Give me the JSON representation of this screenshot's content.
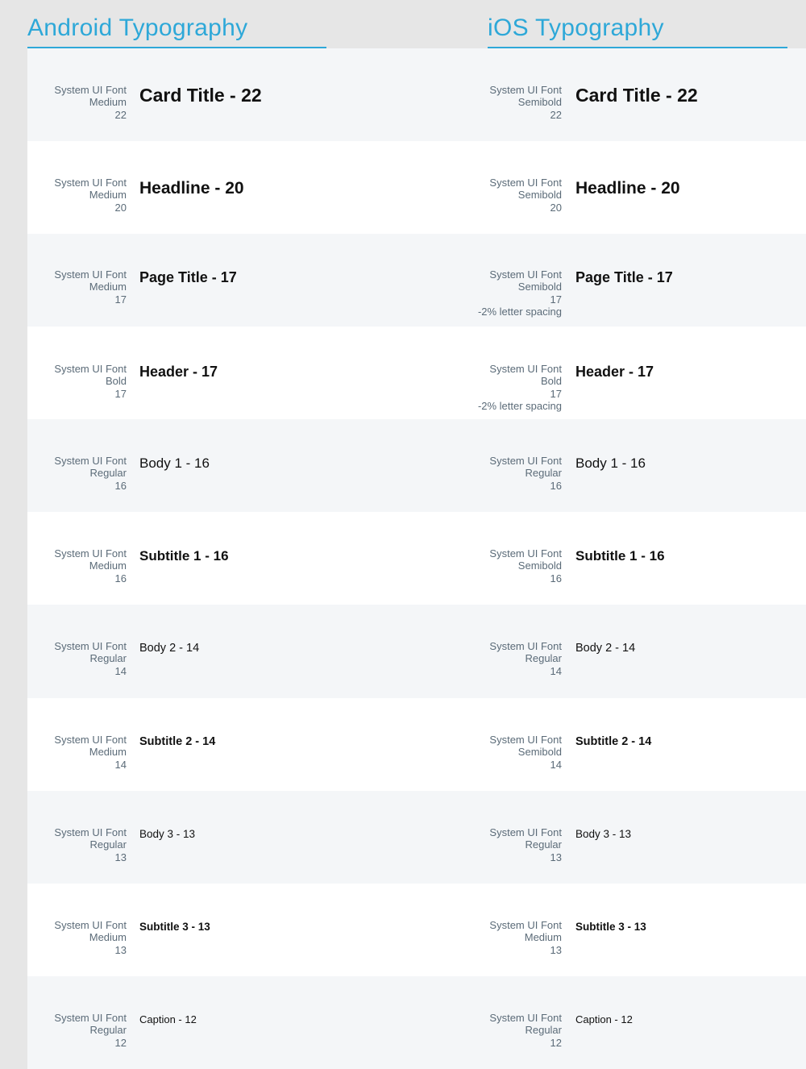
{
  "headings": {
    "android": "Android Typography",
    "ios": "iOS Typography"
  },
  "rows": [
    {
      "android": {
        "meta": [
          "System UI Font",
          "Medium",
          "22"
        ],
        "sample": "Card Title - 22"
      },
      "ios": {
        "meta": [
          "System UI Font",
          "Semibold",
          "22"
        ],
        "sample": "Card Title - 22"
      }
    },
    {
      "android": {
        "meta": [
          "System UI Font",
          "Medium",
          "20"
        ],
        "sample": "Headline - 20"
      },
      "ios": {
        "meta": [
          "System UI Font",
          "Semibold",
          "20"
        ],
        "sample": "Headline - 20"
      }
    },
    {
      "android": {
        "meta": [
          "System UI Font",
          "Medium",
          "17"
        ],
        "sample": "Page Title - 17"
      },
      "ios": {
        "meta": [
          "System UI Font",
          "Semibold",
          "17",
          "-2% letter spacing"
        ],
        "sample": "Page Title - 17"
      }
    },
    {
      "android": {
        "meta": [
          "System UI Font",
          "Bold",
          "17"
        ],
        "sample": "Header - 17"
      },
      "ios": {
        "meta": [
          "System UI Font",
          "Bold",
          "17",
          "-2% letter spacing"
        ],
        "sample": "Header - 17"
      }
    },
    {
      "android": {
        "meta": [
          "System UI Font",
          "Regular",
          "16"
        ],
        "sample": "Body 1 - 16"
      },
      "ios": {
        "meta": [
          "System UI Font",
          "Regular",
          "16"
        ],
        "sample": "Body 1 - 16"
      }
    },
    {
      "android": {
        "meta": [
          "System UI Font",
          "Medium",
          "16"
        ],
        "sample": "Subtitle 1 - 16"
      },
      "ios": {
        "meta": [
          "System UI Font",
          "Semibold",
          "16"
        ],
        "sample": "Subtitle 1 - 16"
      }
    },
    {
      "android": {
        "meta": [
          "System UI Font",
          "Regular",
          "14"
        ],
        "sample": "Body 2 - 14"
      },
      "ios": {
        "meta": [
          "System UI Font",
          "Regular",
          "14"
        ],
        "sample": "Body 2 - 14"
      }
    },
    {
      "android": {
        "meta": [
          "System UI Font",
          "Medium",
          "14"
        ],
        "sample": "Subtitle 2 - 14"
      },
      "ios": {
        "meta": [
          "System UI Font",
          "Semibold",
          "14"
        ],
        "sample": "Subtitle 2 - 14"
      }
    },
    {
      "android": {
        "meta": [
          "System UI Font",
          "Regular",
          "13"
        ],
        "sample": "Body 3 - 13"
      },
      "ios": {
        "meta": [
          "System UI Font",
          "Regular",
          "13"
        ],
        "sample": "Body 3 - 13"
      }
    },
    {
      "android": {
        "meta": [
          "System UI Font",
          "Medium",
          "13"
        ],
        "sample": "Subtitle 3 - 13"
      },
      "ios": {
        "meta": [
          "System UI Font",
          "Medium",
          "13"
        ],
        "sample": "Subtitle 3 - 13"
      }
    },
    {
      "android": {
        "meta": [
          "System UI Font",
          "Regular",
          "12"
        ],
        "sample": "Caption - 12"
      },
      "ios": {
        "meta": [
          "System UI Font",
          "Regular",
          "12"
        ],
        "sample": "Caption - 12"
      }
    }
  ],
  "colors": {
    "accent": "#2ea8d8",
    "meta_text": "#5b6b78",
    "sample_text": "#111111",
    "row_shaded": "#f4f6f8",
    "row_white": "#ffffff",
    "page_background": "#e6e6e6"
  }
}
